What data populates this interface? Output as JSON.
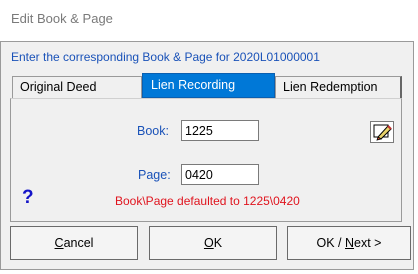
{
  "window": {
    "title": "Edit Book & Page"
  },
  "instruction": "Enter the corresponding Book & Page for 2020L01000001",
  "tabs": [
    {
      "label": "Original Deed",
      "selected": false
    },
    {
      "label": "Lien Recording",
      "selected": true
    },
    {
      "label": "Lien Redemption",
      "selected": false
    }
  ],
  "form": {
    "book_label": "Book:",
    "book_value": "1225",
    "page_label": "Page:",
    "page_value": "0420",
    "message": "Book\\Page defaulted to 1225\\0420",
    "help_glyph": "?"
  },
  "buttons": {
    "cancel": {
      "accel": "C",
      "rest": "ancel"
    },
    "ok": {
      "accel": "O",
      "rest": "K"
    },
    "ok_next": {
      "prefix": "OK / ",
      "accel": "N",
      "rest": "ext >"
    }
  },
  "icons": {
    "edit": "pencil-edit-icon"
  },
  "colors": {
    "accent": "#0078d7",
    "label_blue": "#1a52b8",
    "error": "#e0141e"
  }
}
